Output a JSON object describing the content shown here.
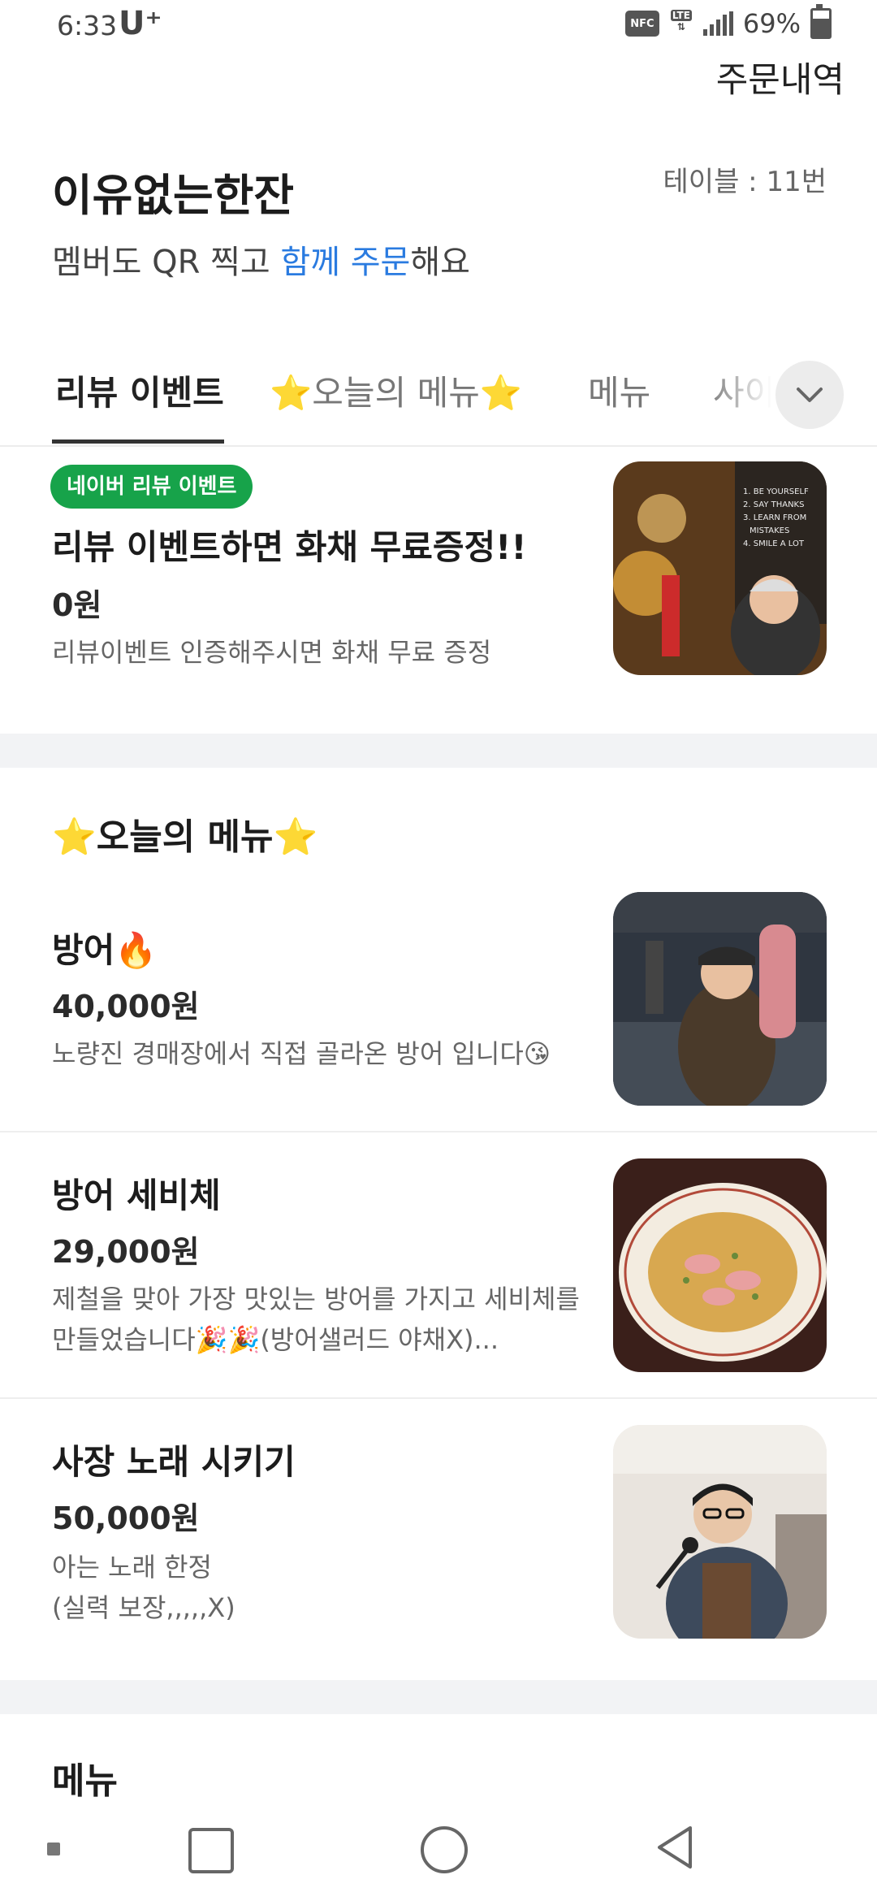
{
  "status_bar": {
    "time": "6:33",
    "carrier": "U⁺",
    "nfc": "NFC",
    "lte": "LTE",
    "battery": "69%"
  },
  "header": {
    "order_history": "주문내역",
    "store_name": "이유없는한잔",
    "table": "테이블 : 11번",
    "subtitle_pre": "멤버도 QR 찍고 ",
    "subtitle_highlight": "함께 주문",
    "subtitle_post": "해요"
  },
  "tabs": [
    {
      "label": "리뷰 이벤트"
    },
    {
      "label": "⭐오늘의 메뉴⭐"
    },
    {
      "label": "메뉴"
    },
    {
      "label": "사이"
    }
  ],
  "review_event": {
    "badge": "네이버 리뷰 이벤트",
    "title": "리뷰 이벤트하면 화채 무료증정!!",
    "price": "0원",
    "desc": "리뷰이벤트 인증해주시면 화채 무료 증정",
    "image_text": [
      "1. BE YOURSELF",
      "2. SAY THANKS",
      "3. LEARN FROM",
      "MISTAKES",
      "4. SMILE A LOT"
    ]
  },
  "today_section": {
    "title": "⭐오늘의 메뉴⭐",
    "items": [
      {
        "name": "방어🔥",
        "price": "40,000원",
        "desc": "노량진 경매장에서 직접 골라온 방어 입니다😘"
      },
      {
        "name": "방어 세비체",
        "price": "29,000원",
        "desc": "제철을 맞아 가장 맛있는 방어를 가지고 세비체를 만들었습니다🎉🎉(방어샐러드 야채X)..."
      },
      {
        "name": "사장 노래 시키기",
        "price": "50,000원",
        "desc_line1": "아는 노래 한정",
        "desc_line2": "(실력 보장,,,,,X)"
      }
    ]
  },
  "menu_section": {
    "title": "메뉴"
  },
  "colors": {
    "accent_blue": "#2a7be0",
    "badge_green": "#17a34a",
    "divider": "#f2f3f5"
  }
}
